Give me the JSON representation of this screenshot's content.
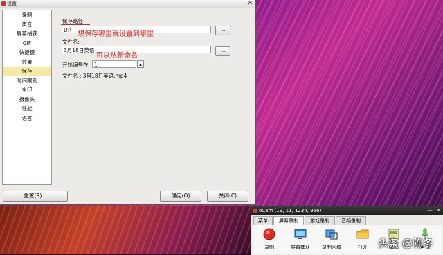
{
  "dialog": {
    "title": "设置",
    "close": "✕",
    "sidebar": [
      "录制",
      "声音",
      "屏幕捕获",
      "GIF",
      "快捷键",
      "效果",
      "保存",
      "时间限制",
      "水印",
      "摄像头",
      "性能",
      "语言"
    ],
    "active_index": 6,
    "save_path_label": "保存路径:",
    "save_path_value": "D:\\",
    "browse": "...",
    "filename_label": "文件名:",
    "filename_value": "3月18日英语",
    "start_number_label": "开始编号在:",
    "start_number_value": "1",
    "filename_preview": "文件名 : 3月18日英语.mp4",
    "annotation_path": "想保存哪里就设置到哪里",
    "annotation_name": "可以从新命名",
    "reset_button": "重置(R)...",
    "ok_button": "确定(O)",
    "close_button": "关闭(C)"
  },
  "ocam": {
    "title": "oCam (19, 11, 1234, 956)",
    "minimize": "—",
    "close": "✕",
    "tabs": [
      "菜单",
      "屏幕录制",
      "游戏录制",
      "音频录制"
    ],
    "active_tab": 1,
    "tools": [
      {
        "label": "录制",
        "icon": "record-icon"
      },
      {
        "label": "屏幕捕获",
        "icon": "monitor-icon"
      },
      {
        "label": "录制区域",
        "icon": "region-icon"
      },
      {
        "label": "打开",
        "icon": "folder-icon"
      },
      {
        "label": "编码",
        "icon": "codec-icon"
      },
      {
        "label": "声音",
        "icon": "sound-icon"
      }
    ]
  },
  "watermark": "头条 @陈冬",
  "colors": {
    "annotation": "#e02020",
    "active_item": "#f6e9a8",
    "record": "#e02a23"
  }
}
